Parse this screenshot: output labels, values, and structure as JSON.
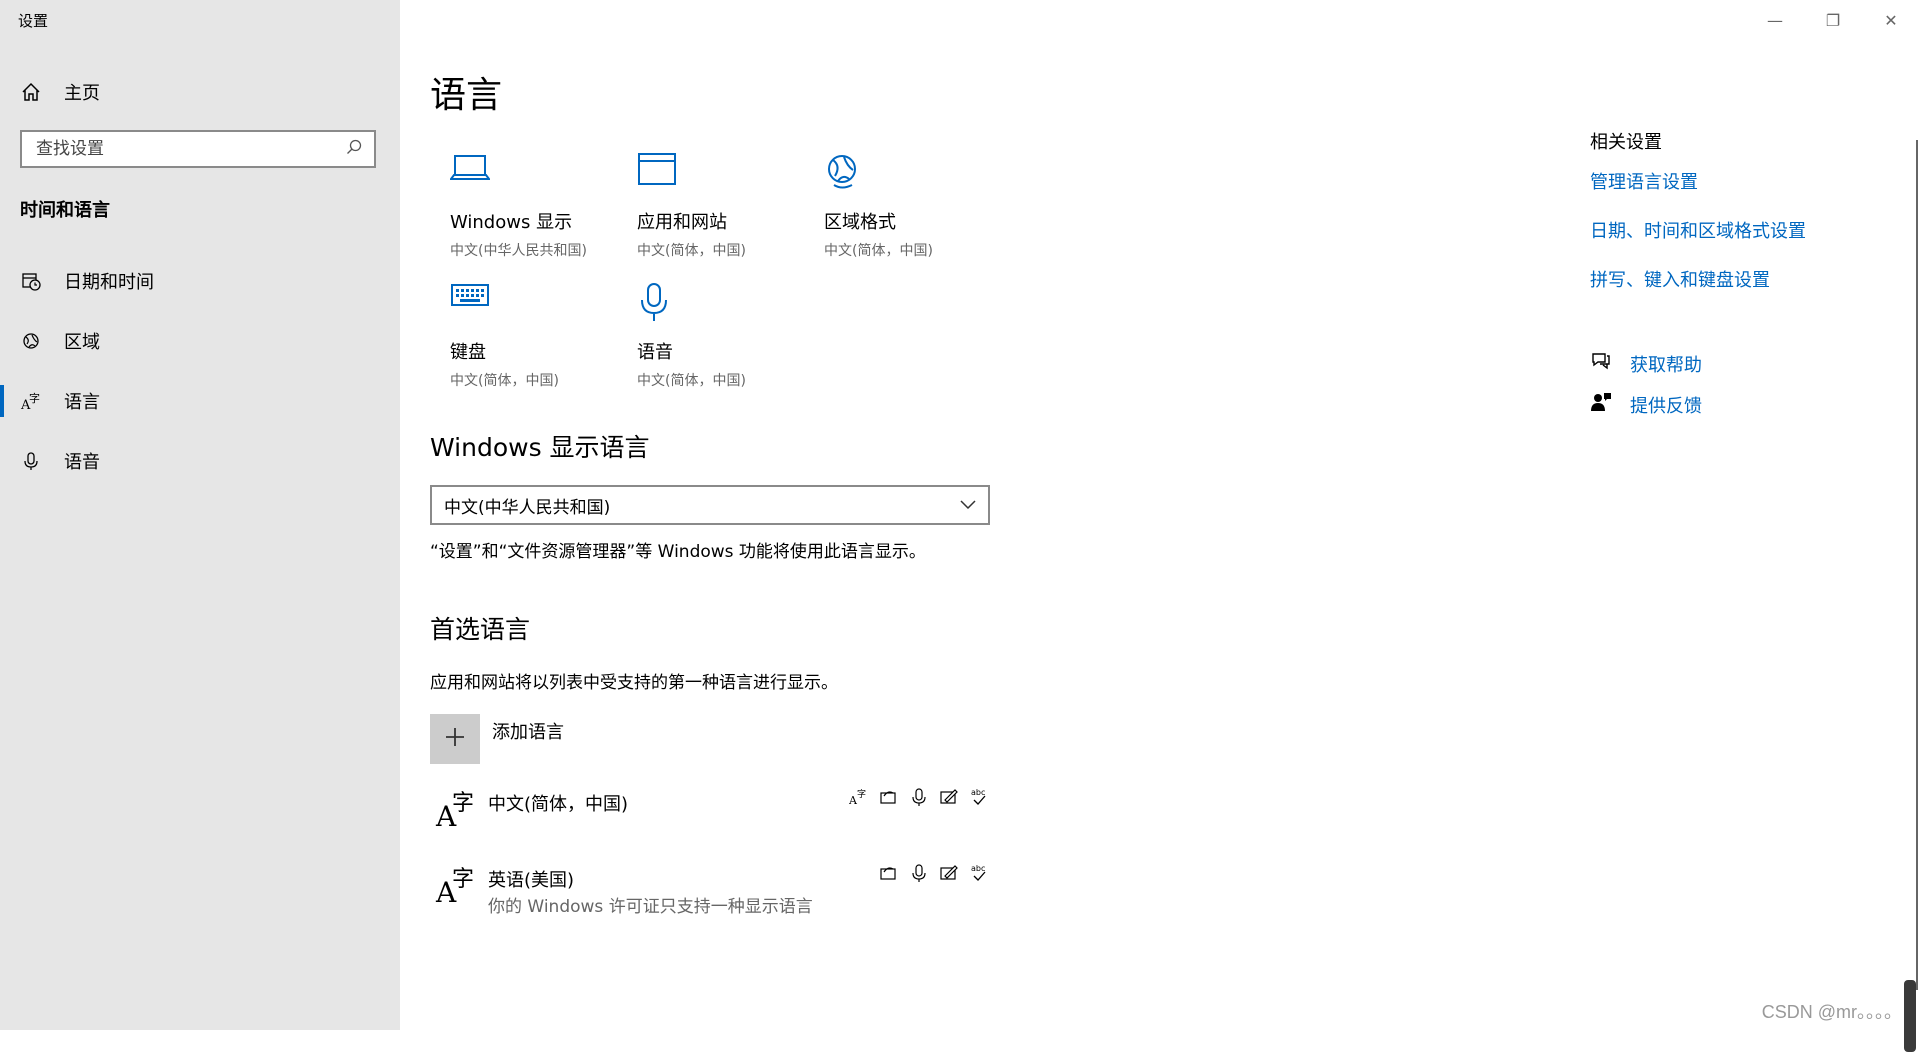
{
  "app": {
    "title": "设置"
  },
  "sidebar": {
    "home": "主页",
    "search_placeholder": "查找设置",
    "section_title": "时间和语言",
    "items": [
      {
        "label": "日期和时间",
        "icon": "calendar-clock-icon"
      },
      {
        "label": "区域",
        "icon": "globe-region-icon"
      },
      {
        "label": "语言",
        "icon": "language-icon",
        "active": true
      },
      {
        "label": "语音",
        "icon": "microphone-icon"
      }
    ]
  },
  "window": {
    "minimize": "—",
    "restore": "❐",
    "close": "✕"
  },
  "main": {
    "title": "语言",
    "tiles": [
      {
        "name": "Windows 显示",
        "sub": "中文(中华人民共和国)",
        "icon": "laptop-icon"
      },
      {
        "name": "应用和网站",
        "sub": "中文(简体，中国)",
        "icon": "browser-window-icon"
      },
      {
        "name": "区域格式",
        "sub": "中文(简体，中国)",
        "icon": "globe-format-icon"
      },
      {
        "name": "键盘",
        "sub": "中文(简体，中国)",
        "icon": "keyboard-icon"
      },
      {
        "name": "语音",
        "sub": "中文(简体，中国)",
        "icon": "microphone-icon"
      }
    ],
    "display_lang": {
      "heading": "Windows 显示语言",
      "selected": "中文(中华人民共和国)",
      "note": "“设置”和“文件资源管理器”等 Windows 功能将使用此语言显示。"
    },
    "preferred": {
      "heading": "首选语言",
      "note": "应用和网站将以列表中受支持的第一种语言进行显示。",
      "add_label": "添加语言",
      "languages": [
        {
          "name": "中文(简体，中国)",
          "sub": ""
        },
        {
          "name": "英语(美国)",
          "sub": "你的 Windows 许可证只支持一种显示语言"
        }
      ]
    }
  },
  "related": {
    "title": "相关设置",
    "links": [
      "管理语言设置",
      "日期、时间和区域格式设置",
      "拼写、键入和键盘设置"
    ],
    "help": "获取帮助",
    "feedback": "提供反馈"
  },
  "watermark": "CSDN @mr。。。。",
  "colors": {
    "accent": "#0067c0",
    "sidebar_bg": "#e6e6e6"
  }
}
